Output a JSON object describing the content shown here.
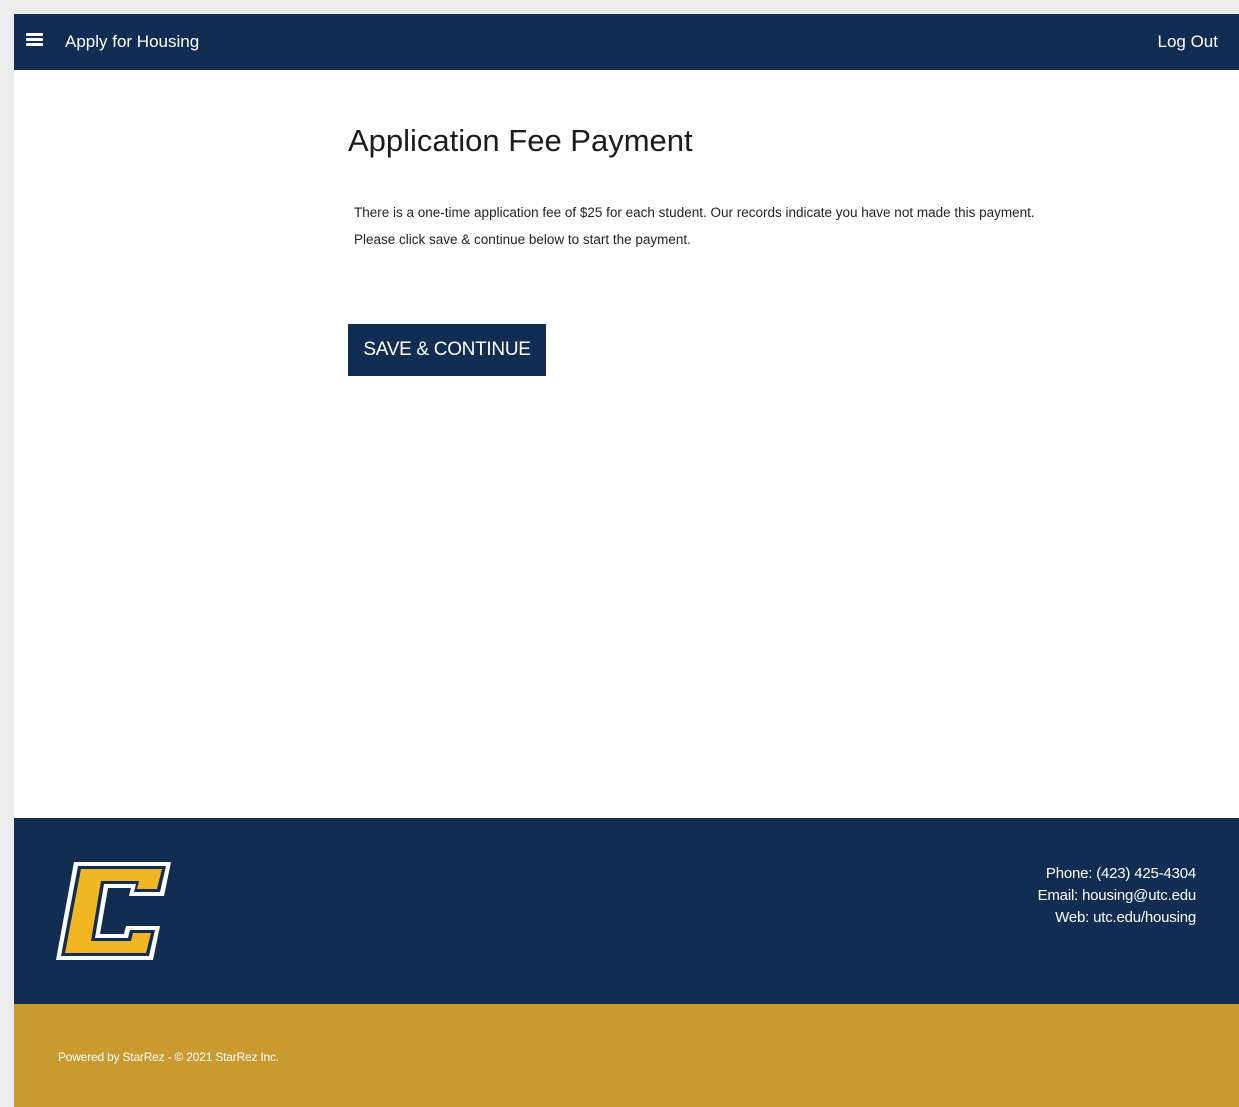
{
  "header": {
    "menu_icon": "hamburger-menu-icon",
    "title": "Apply for Housing",
    "logout_label": "Log Out"
  },
  "main": {
    "title": "Application Fee Payment",
    "fee_line1": "There is a one-time application fee of $25 for each student. Our records indicate you have not made this payment.",
    "fee_line2": "Please click save & continue below to start the payment.",
    "save_button_label": "SAVE & CONTINUE"
  },
  "footer": {
    "logo_icon": "utc-c-logo",
    "phone": "Phone: (423) 425-4304",
    "email": "Email: housing@utc.edu",
    "web": "Web: utc.edu/housing",
    "powered_by": "Powered by StarRez - © 2021 StarRez Inc."
  },
  "colors": {
    "navy": "#122d52",
    "gold": "#c99a30",
    "logo_yellow": "#f1b621",
    "background": "#ffffff"
  }
}
